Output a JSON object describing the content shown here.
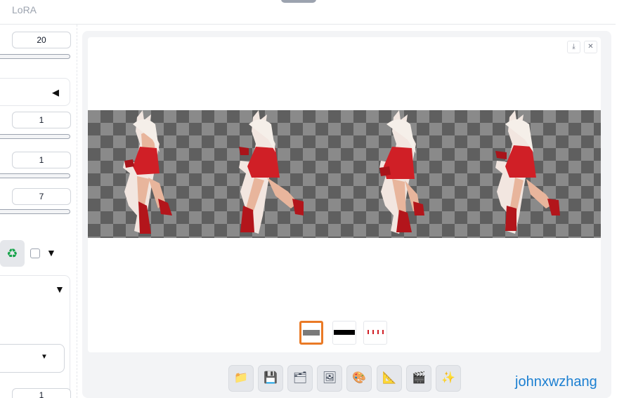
{
  "header": {
    "tab_label": "LoRA"
  },
  "sidebar": {
    "fields": [
      "20",
      "1",
      "1",
      "7"
    ],
    "partial_field": "1",
    "recycle_icon": "recycle-icon",
    "caret_icons": [
      "triangle-left-icon",
      "triangle-down-icon",
      "caret-down-icon"
    ]
  },
  "gallery": {
    "download_icon": "download-icon",
    "close_icon": "close-icon",
    "thumbnail_count": 3,
    "selected_thumbnail": 1
  },
  "toolbar": {
    "buttons": [
      {
        "icon": "folder-icon",
        "glyph": "📁"
      },
      {
        "icon": "save-icon",
        "glyph": "💾"
      },
      {
        "icon": "zip-icon",
        "glyph": "🗂"
      },
      {
        "icon": "image-icon",
        "glyph": "🖼"
      },
      {
        "icon": "palette-icon",
        "glyph": "🎨"
      },
      {
        "icon": "ruler-icon",
        "glyph": "📐"
      },
      {
        "icon": "clapper-icon",
        "glyph": "🎬"
      },
      {
        "icon": "sparkles-icon",
        "glyph": "✨"
      }
    ]
  },
  "watermark": "johnxwzhang",
  "colors": {
    "selected_border": "#ea7a26",
    "watermark": "#1b7fd1",
    "accent_dress": "#d01f26"
  }
}
